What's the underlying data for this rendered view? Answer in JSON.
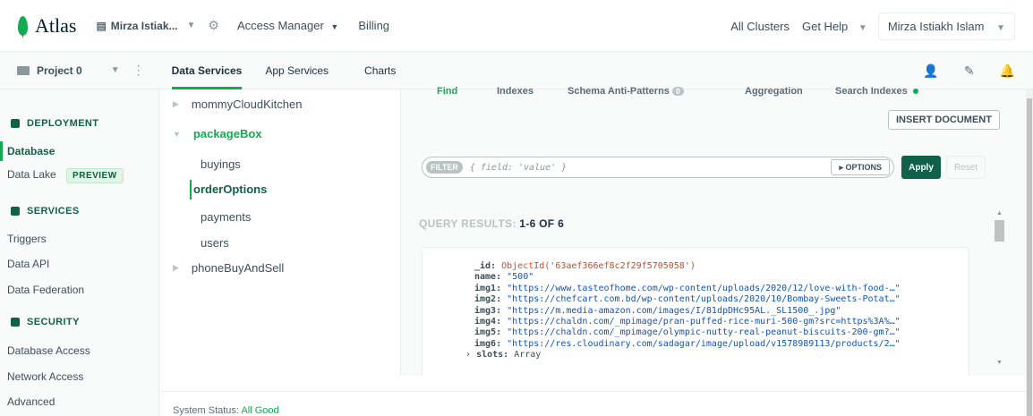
{
  "topbar": {
    "logo_text": "Atlas",
    "org_name": "Mirza Istiak...",
    "access_manager": "Access Manager",
    "billing": "Billing",
    "all_clusters": "All Clusters",
    "get_help": "Get Help",
    "user_name": "Mirza Istiakh Islam"
  },
  "projbar": {
    "project": "Project 0",
    "tabs": [
      "Data Services",
      "App Services",
      "Charts"
    ]
  },
  "sidebar": {
    "deployment_title": "DEPLOYMENT",
    "database": "Database",
    "data_lake": "Data Lake",
    "preview_badge": "PREVIEW",
    "services_title": "SERVICES",
    "triggers": "Triggers",
    "data_api": "Data API",
    "data_federation": "Data Federation",
    "security_title": "SECURITY",
    "database_access": "Database Access",
    "network_access": "Network Access",
    "advanced": "Advanced"
  },
  "tree": {
    "db1": "mommyCloudKitchen",
    "db2": "packageBox",
    "collections": [
      "buyings",
      "orderOptions",
      "payments",
      "users"
    ],
    "db3": "phoneBuyAndSell"
  },
  "main": {
    "tabs": {
      "find": "Find",
      "indexes": "Indexes",
      "schema": "Schema Anti-Patterns",
      "schema_count": "0",
      "aggregation": "Aggregation",
      "search": "Search Indexes"
    },
    "insert_document": "INSERT DOCUMENT",
    "filter_tag": "FILTER",
    "filter_placeholder": "{ field: 'value' }",
    "options": "▸ OPTIONS",
    "apply": "Apply",
    "reset": "Reset",
    "query_results_label": "QUERY RESULTS:",
    "query_results_count": "1-6 OF 6",
    "document": {
      "id_key": "_id:",
      "id_value": "ObjectId('63aef366ef8c2f29f5705058')",
      "name_key": "name:",
      "name_value": "\"500\"",
      "img1_key": "img1:",
      "img1_value": "\"https://www.tasteofhome.com/wp-content/uploads/2020/12/love-with-food-…\"",
      "img2_key": "img2:",
      "img2_value": "\"https://chefcart.com.bd/wp-content/uploads/2020/10/Bombay-Sweets-Potat…\"",
      "img3_key": "img3:",
      "img3_value": "\"https://m.media-amazon.com/images/I/81dpDHc95AL._SL1500_.jpg\"",
      "img4_key": "img4:",
      "img4_value": "\"https://chaldn.com/_mpimage/pran-puffed-rice-muri-500-gm?src=https%3A%…\"",
      "img5_key": "img5:",
      "img5_value": "\"https://chaldn.com/_mpimage/olympic-nutty-real-peanut-biscuits-200-gm?…\"",
      "img6_key": "img6:",
      "img6_value": "\"https://res.cloudinary.com/sadagar/image/upload/v1578989113/products/2…\"",
      "slots_key": "slots:",
      "slots_value": "Array"
    }
  },
  "status": {
    "label": "System Status:",
    "value": "All Good"
  },
  "colors": {
    "brand_green": "#13aa52",
    "dark_green": "#116149",
    "object_id": "#cf4a22",
    "string_value": "#1254b7"
  }
}
